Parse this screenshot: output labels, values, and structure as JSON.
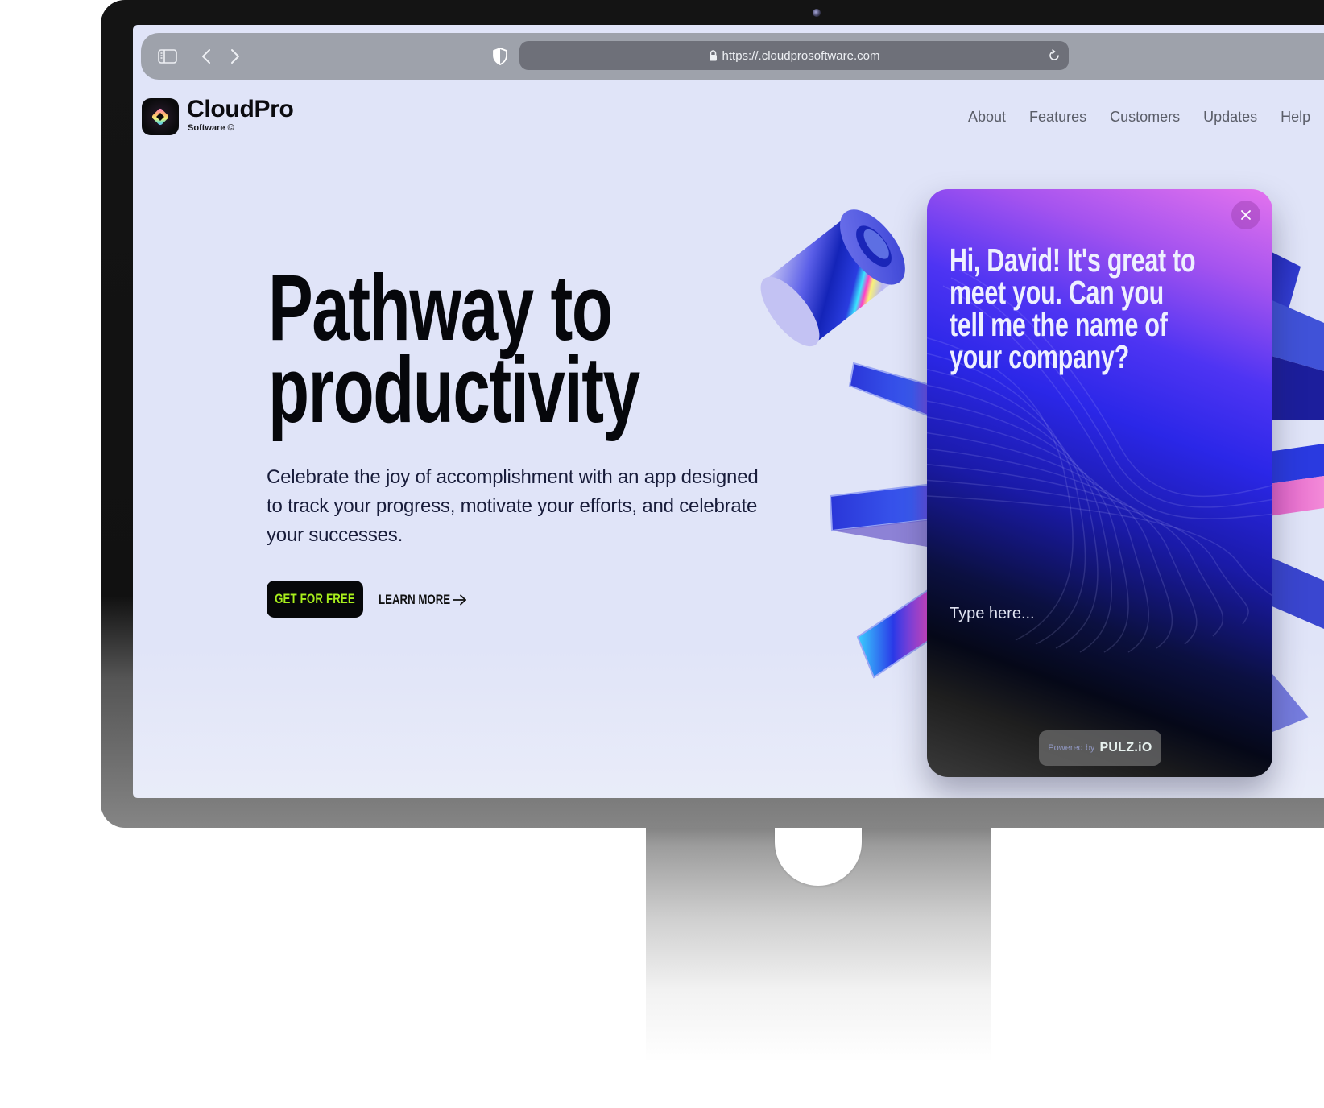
{
  "browser": {
    "url": "https://.cloudprosoftware.com",
    "icons": {
      "sidebar": "sidebar-toggle-icon",
      "back": "chevron-left-icon",
      "forward": "chevron-right-icon",
      "privacy": "shield-icon",
      "lock": "lock-icon",
      "reload": "reload-icon"
    }
  },
  "site": {
    "brand": {
      "name": "CloudPro",
      "subtitle": "Software ©",
      "logo_icon": "diamond-logo-icon"
    },
    "nav": [
      {
        "label": "About"
      },
      {
        "label": "Features"
      },
      {
        "label": "Customers"
      },
      {
        "label": "Updates"
      },
      {
        "label": "Help"
      }
    ],
    "hero": {
      "headline_line1": "Pathway to",
      "headline_line2": "productivity",
      "subtext": "Celebrate the joy of accomplishment with an app designed to track your progress, motivate your efforts, and celebrate your successes.",
      "primary_cta": "GET FOR FREE",
      "secondary_cta": "LEARN MORE",
      "secondary_cta_icon": "arrow-right-icon"
    },
    "colors": {
      "background": "#e0e4f8",
      "cta_bg": "#060709",
      "cta_text": "#a8ef1c",
      "headline": "#06070b"
    }
  },
  "chat_widget": {
    "message": "Hi, David! It's great to meet you. Can you tell me the name of your company?",
    "input_placeholder": "Type here...",
    "close_icon": "close-icon",
    "powered_by_label": "Powered by",
    "powered_by_brand": "PULZ.iO",
    "colors": {
      "gradient_top": "#e473ee",
      "gradient_mid": "#2b27e8",
      "gradient_bottom": "#3a3a3a"
    }
  }
}
